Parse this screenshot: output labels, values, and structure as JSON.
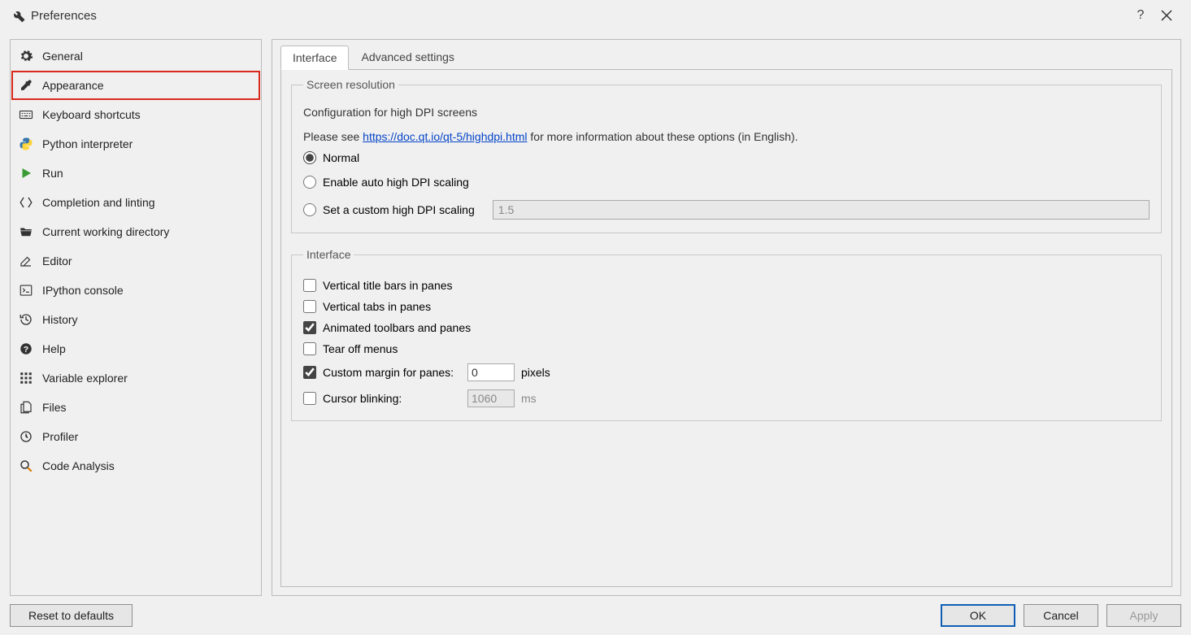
{
  "window": {
    "title": "Preferences"
  },
  "sidebar": {
    "items": [
      {
        "label": "General",
        "icon": "gears"
      },
      {
        "label": "Appearance",
        "icon": "eyedropper",
        "highlighted": true
      },
      {
        "label": "Keyboard shortcuts",
        "icon": "keyboard"
      },
      {
        "label": "Python interpreter",
        "icon": "python"
      },
      {
        "label": "Run",
        "icon": "play"
      },
      {
        "label": "Completion and linting",
        "icon": "completion"
      },
      {
        "label": "Current working directory",
        "icon": "folder"
      },
      {
        "label": "Editor",
        "icon": "edit"
      },
      {
        "label": "IPython console",
        "icon": "console"
      },
      {
        "label": "History",
        "icon": "history"
      },
      {
        "label": "Help",
        "icon": "help"
      },
      {
        "label": "Variable explorer",
        "icon": "grid"
      },
      {
        "label": "Files",
        "icon": "files"
      },
      {
        "label": "Profiler",
        "icon": "clock"
      },
      {
        "label": "Code Analysis",
        "icon": "magnify"
      }
    ]
  },
  "tabs": [
    {
      "label": "Interface",
      "active": true
    },
    {
      "label": "Advanced settings",
      "active": false
    }
  ],
  "screen_resolution": {
    "legend": "Screen resolution",
    "subtitle": "Configuration for high DPI screens",
    "please_see": "Please see ",
    "link_text": "https://doc.qt.io/qt-5/highdpi.html",
    "after_link": " for more information about these options (in English).",
    "options": {
      "normal": "Normal",
      "auto": "Enable auto high DPI scaling",
      "custom": "Set a custom high DPI scaling",
      "custom_value": "1.5"
    }
  },
  "interface_group": {
    "legend": "Interface",
    "vertical_title_bars": "Vertical title bars in panes",
    "vertical_tabs": "Vertical tabs in panes",
    "animated": "Animated toolbars and panes",
    "tear_off": "Tear off menus",
    "custom_margin_label": "Custom margin for panes:",
    "custom_margin_value": "0",
    "custom_margin_unit": "pixels",
    "cursor_blinking_label": "Cursor blinking:",
    "cursor_blinking_value": "1060",
    "cursor_blinking_unit": "ms"
  },
  "footer": {
    "reset": "Reset to defaults",
    "ok": "OK",
    "cancel": "Cancel",
    "apply": "Apply"
  }
}
